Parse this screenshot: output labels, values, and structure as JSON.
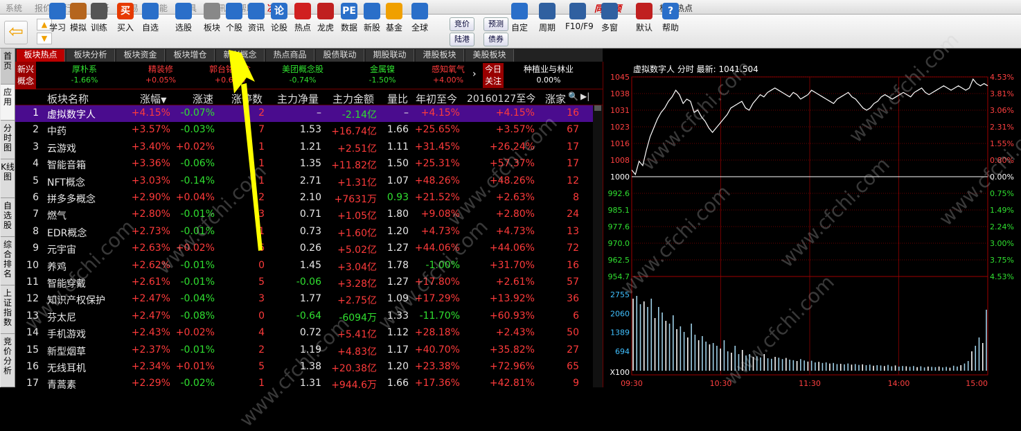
{
  "menu": {
    "items": [
      "系统",
      "报价",
      "行情",
      "分析",
      "交易",
      "智能",
      "工具",
      "资讯",
      "帮助",
      "决策"
    ],
    "brand": "同花顺",
    "title": "板块热点"
  },
  "toolbar": {
    "buttons": [
      {
        "label": "学习",
        "icon": "graduation-cap-icon"
      },
      {
        "label": "模拟",
        "icon": "gavel-icon"
      },
      {
        "label": "训练",
        "icon": "bars-icon"
      },
      {
        "label": "买入",
        "icon": "buy-icon",
        "glyph": "买"
      },
      {
        "label": "自选",
        "icon": "star-icon"
      },
      {
        "label": "选股",
        "icon": "magnifier-chart-icon"
      },
      {
        "label": "板块",
        "icon": "sphere-icon"
      },
      {
        "label": "个股",
        "icon": "line-chart-icon"
      },
      {
        "label": "资讯",
        "icon": "document-icon"
      },
      {
        "label": "论股",
        "icon": "chat-icon",
        "glyph": "论"
      },
      {
        "label": "热点",
        "icon": "hot-icon"
      },
      {
        "label": "龙虎",
        "icon": "dragon-icon"
      },
      {
        "label": "数据",
        "icon": "pe-icon",
        "glyph": "PE"
      },
      {
        "label": "新股",
        "icon": "newstock-icon"
      },
      {
        "label": "基金",
        "icon": "fund-icon"
      },
      {
        "label": "全球",
        "icon": "globe-icon"
      },
      {
        "label": "自定",
        "icon": "customize-icon"
      },
      {
        "label": "周期",
        "icon": "clock-icon"
      },
      {
        "label": "F10/F9",
        "icon": "f10-icon"
      },
      {
        "label": "多窗",
        "icon": "multiwindow-icon"
      },
      {
        "label": "默认",
        "icon": "home-icon"
      },
      {
        "label": "帮助",
        "icon": "help-icon",
        "glyph": "?"
      }
    ],
    "small_buttons": [
      "竞价",
      "预测",
      "陆港",
      "债券"
    ]
  },
  "left_tabs": [
    "首页",
    "应用",
    "分时图",
    "K线图",
    "自选股",
    "综合排名",
    "上证指数",
    "竞价分析"
  ],
  "tabs": [
    "板块热点",
    "板块分析",
    "板块资金",
    "板块增仓",
    "新兴概念",
    "热点商品",
    "股债联动",
    "期股联动",
    "港股板块",
    "美股板块"
  ],
  "hot_strip": {
    "label": "新兴概念",
    "items": [
      {
        "name": "厚朴系",
        "pct": "-1.66%"
      },
      {
        "name": "精装修",
        "pct": "+0.05%"
      },
      {
        "name": "郭台铭概念",
        "pct": "+0.64%"
      },
      {
        "name": "美团概念股",
        "pct": "-0.74%"
      },
      {
        "name": "金属镍",
        "pct": "-1.50%"
      },
      {
        "name": "感知氧气",
        "pct": "+4.00%"
      }
    ],
    "today_label": "今日关注",
    "focus_name": "种植业与林业",
    "focus_pct": "0.00%"
  },
  "table": {
    "headers": [
      "板块名称",
      "涨幅",
      "涨速",
      "涨停数",
      "主力净量",
      "主力金额",
      "量比",
      "年初至今",
      "20160127至今",
      "涨家"
    ],
    "rows": [
      [
        "1",
        "虚拟数字人",
        "+4.15%",
        "-0.07%",
        "2",
        "–",
        "-2.14亿",
        "–",
        "+4.15%",
        "+4.15%",
        "16"
      ],
      [
        "2",
        "中药",
        "+3.57%",
        "-0.03%",
        "7",
        "1.53",
        "+16.74亿",
        "1.66",
        "+25.65%",
        "+3.57%",
        "67"
      ],
      [
        "3",
        "云游戏",
        "+3.40%",
        "+0.02%",
        "1",
        "1.21",
        "+2.51亿",
        "1.11",
        "+31.45%",
        "+26.24%",
        "17"
      ],
      [
        "4",
        "智能音箱",
        "+3.36%",
        "-0.06%",
        "1",
        "1.35",
        "+11.82亿",
        "1.50",
        "+25.31%",
        "+57.37%",
        "17"
      ],
      [
        "5",
        "NFT概念",
        "+3.03%",
        "-0.14%",
        "1",
        "2.71",
        "+1.31亿",
        "1.07",
        "+48.26%",
        "+48.26%",
        "12"
      ],
      [
        "6",
        "拼多多概念",
        "+2.90%",
        "+0.04%",
        "2",
        "2.10",
        "+7631万",
        "0.93",
        "+21.52%",
        "+2.63%",
        "8"
      ],
      [
        "7",
        "燃气",
        "+2.80%",
        "-0.01%",
        "3",
        "0.71",
        "+1.05亿",
        "1.80",
        "+9.08%",
        "+2.80%",
        "24"
      ],
      [
        "8",
        "EDR概念",
        "+2.73%",
        "-0.01%",
        "1",
        "0.73",
        "+1.60亿",
        "1.20",
        "+4.73%",
        "+4.73%",
        "13"
      ],
      [
        "9",
        "元宇宙",
        "+2.63%",
        "+0.02%",
        "6",
        "0.26",
        "+5.02亿",
        "1.27",
        "+44.06%",
        "+44.06%",
        "72"
      ],
      [
        "10",
        "养鸡",
        "+2.62%",
        "-0.01%",
        "0",
        "1.45",
        "+3.04亿",
        "1.78",
        "-1.00%",
        "+31.70%",
        "16"
      ],
      [
        "11",
        "智能穿戴",
        "+2.61%",
        "-0.01%",
        "5",
        "-0.06",
        "+3.28亿",
        "1.27",
        "+17.80%",
        "+2.61%",
        "57"
      ],
      [
        "12",
        "知识产权保护",
        "+2.47%",
        "-0.04%",
        "3",
        "1.77",
        "+2.75亿",
        "1.09",
        "+17.29%",
        "+13.92%",
        "36"
      ],
      [
        "13",
        "芬太尼",
        "+2.47%",
        "-0.08%",
        "0",
        "-0.64",
        "-6094万",
        "1.33",
        "-11.70%",
        "+60.93%",
        "6"
      ],
      [
        "14",
        "手机游戏",
        "+2.43%",
        "+0.02%",
        "4",
        "0.72",
        "+5.41亿",
        "1.12",
        "+28.18%",
        "+2.43%",
        "50"
      ],
      [
        "15",
        "新型烟草",
        "+2.37%",
        "-0.01%",
        "2",
        "1.19",
        "+4.83亿",
        "1.17",
        "+40.70%",
        "+35.82%",
        "27"
      ],
      [
        "16",
        "无线耳机",
        "+2.34%",
        "+0.01%",
        "5",
        "1.38",
        "+20.38亿",
        "1.20",
        "+23.38%",
        "+72.96%",
        "65"
      ],
      [
        "17",
        "青蒿素",
        "+2.29%",
        "-0.02%",
        "1",
        "1.31",
        "+944.6万",
        "1.66",
        "+17.36%",
        "+42.81%",
        "9"
      ]
    ]
  },
  "chart_data": {
    "type": "line",
    "title": "虚拟数字人 分时 最新: 1041.504",
    "ylim": [
      1000,
      1045
    ],
    "left_ticks": [
      "1045",
      "1038",
      "1031",
      "1023",
      "1016",
      "1008",
      "1000",
      "992.6",
      "985.1",
      "977.6",
      "970.0",
      "962.5",
      "954.7"
    ],
    "right_ticks": [
      "4.53%",
      "3.81%",
      "3.06%",
      "2.31%",
      "1.55%",
      "0.80%",
      "0.00%",
      "0.75%",
      "1.49%",
      "2.24%",
      "3.00%",
      "3.75%",
      "4.53%"
    ],
    "x_labels": [
      "09:30",
      "10:30",
      "11:30",
      "14:00",
      "15:00"
    ],
    "volume_ticks": [
      "2755",
      "2060",
      "1389",
      "694",
      "X100"
    ],
    "price": [
      1003,
      1001,
      1007,
      1005,
      1012,
      1018,
      1022,
      1026,
      1029,
      1031,
      1034,
      1036,
      1039,
      1037,
      1033,
      1035,
      1034,
      1029,
      1030,
      1027,
      1025,
      1022,
      1020,
      1022,
      1024,
      1026,
      1028,
      1031,
      1032,
      1033,
      1034,
      1031,
      1030,
      1033,
      1035,
      1037,
      1036,
      1038,
      1039,
      1040,
      1039,
      1038,
      1037,
      1036,
      1038,
      1037,
      1035,
      1036,
      1037,
      1039,
      1038,
      1037,
      1036,
      1035,
      1034,
      1033,
      1035,
      1036,
      1037,
      1038,
      1036,
      1035,
      1033,
      1031,
      1030,
      1031,
      1033,
      1034,
      1036,
      1037,
      1036,
      1035,
      1036,
      1037,
      1038,
      1037,
      1036,
      1038,
      1039,
      1040,
      1038,
      1037,
      1038,
      1039,
      1040,
      1041,
      1040,
      1039,
      1040,
      1041,
      1040,
      1039,
      1040,
      1044,
      1042,
      1041,
      1042,
      1041
    ],
    "volume": [
      2600,
      2700,
      2400,
      2500,
      2300,
      2600,
      1900,
      2300,
      2100,
      1800,
      1700,
      2000,
      1500,
      1600,
      1400,
      1200,
      1700,
      1300,
      1100,
      1250,
      1050,
      950,
      1000,
      900,
      800,
      1100,
      700,
      650,
      900,
      600,
      750,
      550,
      600,
      500,
      520,
      480,
      600,
      450,
      430,
      500,
      470,
      420,
      460,
      400,
      380,
      350,
      420,
      370,
      330,
      360,
      300,
      320,
      280,
      300,
      260,
      280,
      240,
      250,
      230,
      260,
      220,
      240,
      210,
      230,
      200,
      220,
      180,
      200,
      190,
      170,
      210,
      160,
      190,
      150,
      170,
      160,
      140,
      170,
      130,
      160,
      120,
      150,
      140,
      130,
      150,
      120,
      140,
      110,
      180,
      150,
      200,
      260,
      350,
      700,
      900,
      1200,
      1000,
      2200
    ]
  },
  "watermark": "www.cfchi.com",
  "colors": {
    "up": "#ff3b3b",
    "down": "#30e030",
    "selected_row": "#4a0c8e",
    "arrow": "#ffff00",
    "name": "#e8e8e8",
    "number_white": "#e8e8e8",
    "yellow_index": "#ffff00"
  }
}
